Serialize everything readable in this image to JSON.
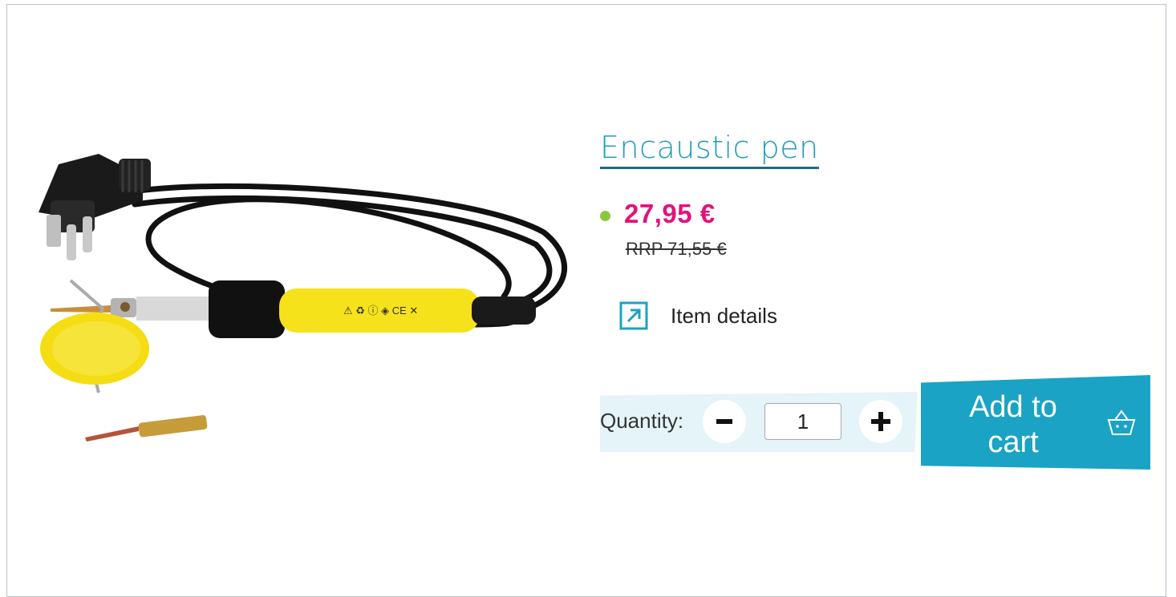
{
  "product": {
    "title": "Encaustic pen",
    "price": "27,95 €",
    "rrp": "RRP 71,55 €",
    "details_label": "Item details",
    "image_icon": "soldering-pen-product-photo"
  },
  "cart": {
    "quantity_label": "Quantity:",
    "quantity_value": "1",
    "add_label": "Add to cart",
    "minus_icon": "minus-icon",
    "plus_icon": "plus-icon",
    "basket_icon": "basket-icon"
  },
  "colors": {
    "title": "#1f9eb8",
    "price": "#e0147a",
    "stock_dot": "#8cc63f",
    "cart_button": "#1aa3c4",
    "quantity_bg": "#e4f4f9"
  }
}
